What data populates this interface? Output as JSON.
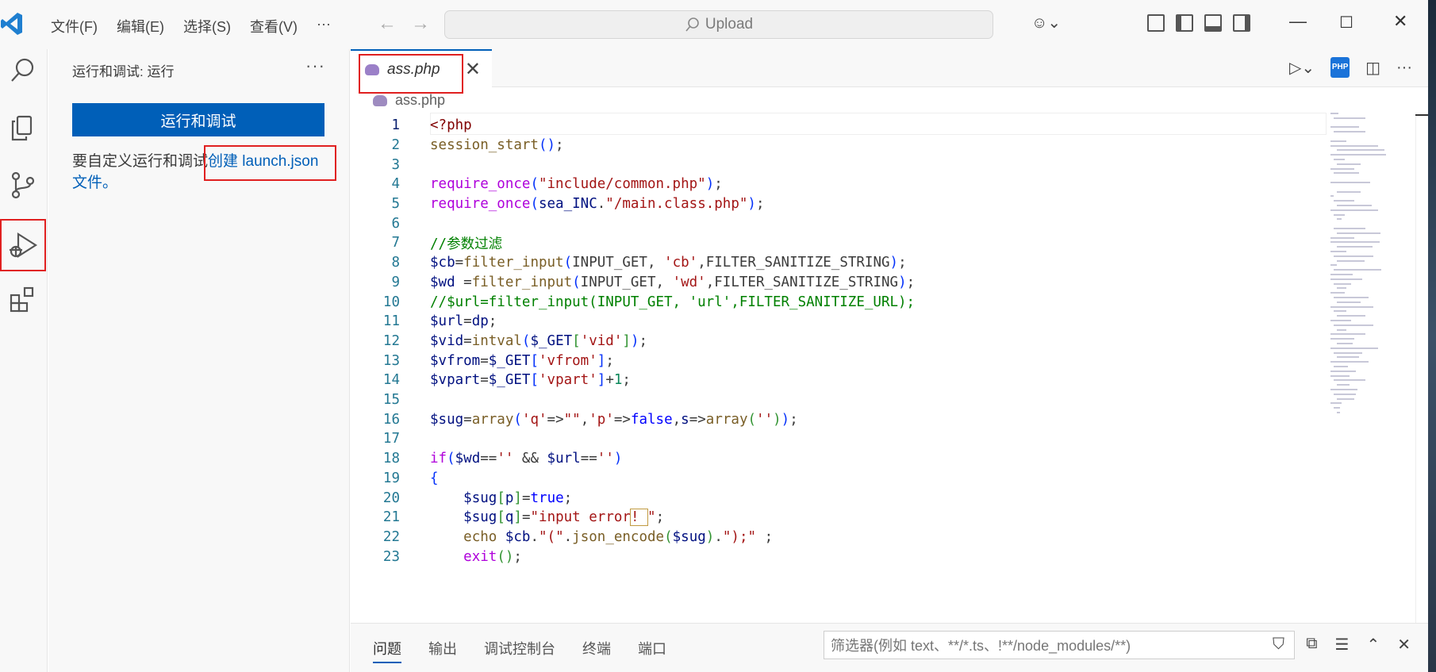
{
  "titlebar": {
    "menu": [
      "文件(F)",
      "编辑(E)",
      "选择(S)",
      "查看(V)",
      "···"
    ],
    "search_text": "Upload"
  },
  "sidebar": {
    "title": "运行和调试: 运行",
    "more": "···",
    "run_button": "运行和调试",
    "hint_prefix": "要自定义运行和调试",
    "hint_link": "创建 launch.json",
    "hint_suffix": "文件。"
  },
  "editor": {
    "tab": {
      "label": "ass.php",
      "close": "✕"
    },
    "breadcrumb": "ass.php",
    "current_line": 1,
    "lines": [
      {
        "n": "1",
        "html": "<span class='t-tag'>&lt;?php</span>"
      },
      {
        "n": "2",
        "html": "<span class='t-fn'>session_start</span><span class='t-br1'>()</span>;"
      },
      {
        "n": "3",
        "html": ""
      },
      {
        "n": "4",
        "html": "<span class='t-kw'>require_once</span><span class='t-br1'>(</span><span class='t-str'>\"include/common.php\"</span><span class='t-br1'>)</span>;"
      },
      {
        "n": "5",
        "html": "<span class='t-kw'>require_once</span><span class='t-br1'>(</span><span class='t-var'>sea_INC</span>.<span class='t-str'>\"/main.class.php\"</span><span class='t-br1'>)</span>;"
      },
      {
        "n": "6",
        "html": ""
      },
      {
        "n": "7",
        "html": "<span class='t-cm'>//参数过滤</span>"
      },
      {
        "n": "8",
        "html": "<span class='t-var'>$cb</span>=<span class='t-fn'>filter_input</span><span class='t-br1'>(</span>INPUT_GET, <span class='t-str'>'cb'</span>,FILTER_SANITIZE_STRING<span class='t-br1'>)</span>;"
      },
      {
        "n": "9",
        "html": "<span class='t-var'>$wd</span> =<span class='t-fn'>filter_input</span><span class='t-br1'>(</span>INPUT_GET, <span class='t-str'>'wd'</span>,FILTER_SANITIZE_STRING<span class='t-br1'>)</span>;"
      },
      {
        "n": "10",
        "html": "<span class='t-cm'>//$url=filter_input(INPUT_GET, 'url',FILTER_SANITIZE_URL);</span>"
      },
      {
        "n": "11",
        "html": "<span class='t-var'>$url</span>=<span class='t-var'>dp</span>;"
      },
      {
        "n": "12",
        "html": "<span class='t-var'>$vid</span>=<span class='t-fn'>intval</span><span class='t-br1'>(</span><span class='t-var'>$_GET</span><span class='t-br2'>[</span><span class='t-str'>'vid'</span><span class='t-br2'>]</span><span class='t-br1'>)</span>;"
      },
      {
        "n": "13",
        "html": "<span class='t-var'>$vfrom</span>=<span class='t-var'>$_GET</span><span class='t-br1'>[</span><span class='t-str'>'vfrom'</span><span class='t-br1'>]</span>;"
      },
      {
        "n": "14",
        "html": "<span class='t-var'>$vpart</span>=<span class='t-var'>$_GET</span><span class='t-br1'>[</span><span class='t-str'>'vpart'</span><span class='t-br1'>]</span>+<span class='t-num'>1</span>;"
      },
      {
        "n": "15",
        "html": ""
      },
      {
        "n": "16",
        "html": "<span class='t-var'>$sug</span>=<span class='t-fn'>array</span><span class='t-br1'>(</span><span class='t-str'>'q'</span>=&gt;<span class='t-str'>\"\"</span>,<span class='t-str'>'p'</span>=&gt;<span class='t-kw2'>false</span>,<span class='t-var'>s</span>=&gt;<span class='t-fn'>array</span><span class='t-br2'>(</span><span class='t-str'>''</span><span class='t-br2'>)</span><span class='t-br1'>)</span>;"
      },
      {
        "n": "17",
        "html": ""
      },
      {
        "n": "18",
        "html": "<span class='t-kw'>if</span><span class='t-br1'>(</span><span class='t-var'>$wd</span>==<span class='t-str'>''</span> &amp;&amp; <span class='t-var'>$url</span>==<span class='t-str'>''</span><span class='t-br1'>)</span>"
      },
      {
        "n": "19",
        "html": "<span class='t-br1'>{</span>"
      },
      {
        "n": "20",
        "html": "    <span class='t-var'>$sug</span><span class='t-br2'>[</span><span class='t-var'>p</span><span class='t-br2'>]</span>=<span class='t-kw2'>true</span>;"
      },
      {
        "n": "21",
        "html": "    <span class='t-var'>$sug</span><span class='t-br2'>[</span><span class='t-var'>q</span><span class='t-br2'>]</span>=<span class='t-str'>\"input error<span class='warn-box'>! </span>\"</span>;"
      },
      {
        "n": "22",
        "html": "    <span class='t-fn'>echo</span> <span class='t-var'>$cb</span>.<span class='t-str'>\"(\"</span>.<span class='t-fn'>json_encode</span><span class='t-br2'>(</span><span class='t-var'>$sug</span><span class='t-br2'>)</span>.<span class='t-str'>\");\"</span> ;"
      },
      {
        "n": "23",
        "html": "    <span class='t-kw'>exit</span><span class='t-br2'>()</span>;"
      }
    ]
  },
  "panel": {
    "tabs": [
      "问题",
      "输出",
      "调试控制台",
      "终端",
      "端口"
    ],
    "active_tab": "问题",
    "filter_placeholder": "筛选器(例如 text、**/*.ts、!**/node_modules/**)"
  },
  "colors": {
    "accent": "#005fb8",
    "highlight_box": "#e02020"
  }
}
